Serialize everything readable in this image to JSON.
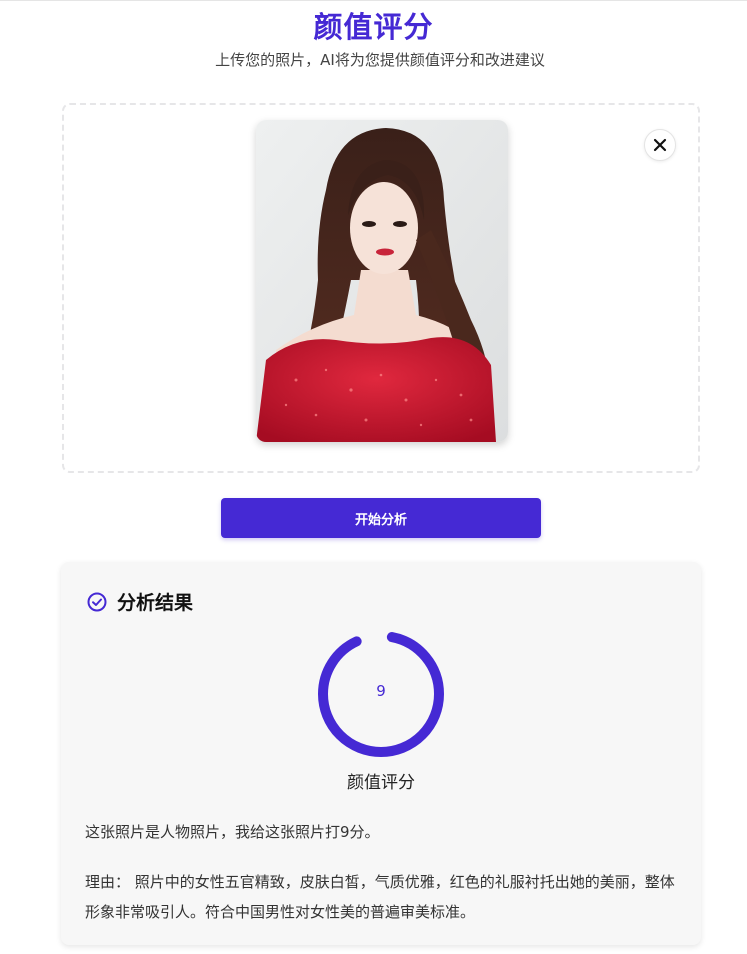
{
  "header": {
    "title": "颜值评分",
    "subtitle": "上传您的照片，AI将为您提供颜值评分和改进建议"
  },
  "upload": {
    "photo_alt": "uploaded portrait photo",
    "close_icon": "close-icon"
  },
  "actions": {
    "analyze_label": "开始分析"
  },
  "result": {
    "title": "分析结果",
    "header_icon": "check-circle-icon",
    "score": "9",
    "score_fraction": 0.9,
    "score_label": "颜值评分",
    "summary": "这张照片是人物照片，我给这张照片打9分。",
    "reason": "理由： 照片中的女性五官精致，皮肤白皙，气质优雅，红色的礼服衬托出她的美丽，整体形象非常吸引人。符合中国男性对女性美的普遍审美标准。"
  },
  "colors": {
    "accent": "#4529d4",
    "card_bg": "#f7f7f7",
    "dress_red": "#c8102e"
  }
}
